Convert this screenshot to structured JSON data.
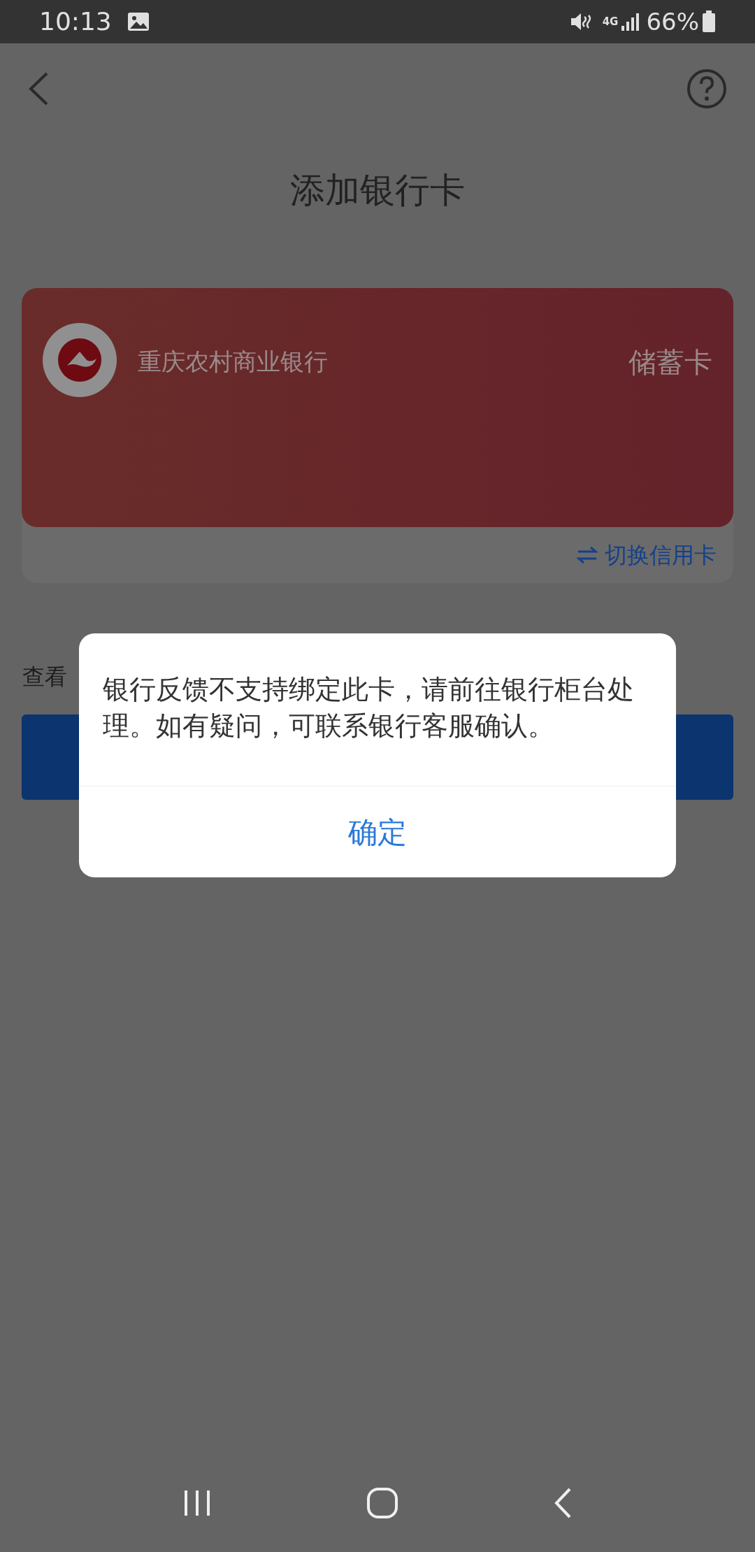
{
  "status_bar": {
    "time": "10:13",
    "battery": "66%",
    "network": "4G"
  },
  "nav": {
    "title": "添加银行卡"
  },
  "card": {
    "bank_name": "重庆农村商业银行",
    "card_type": "储蓄卡",
    "switch_label": "切换信用卡"
  },
  "agreement_text": "查看",
  "dialog": {
    "message": "银行反馈不支持绑定此卡，请前往银行柜台处理。如有疑问，可联系银行客服确认。",
    "button": "确定"
  }
}
